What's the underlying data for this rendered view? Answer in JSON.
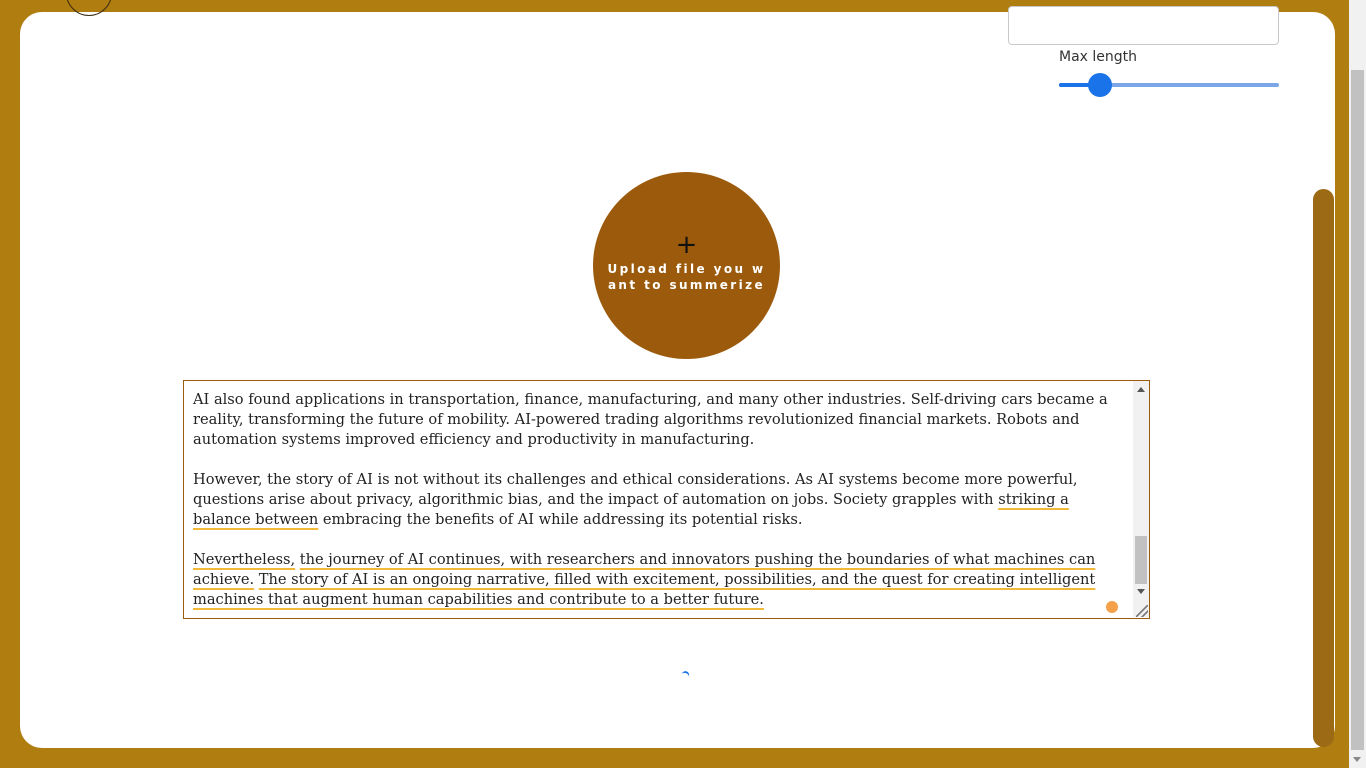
{
  "settings": {
    "max_length_label": "Max length",
    "max_length_value_fraction": 0.12
  },
  "upload": {
    "plus_symbol": "+",
    "label": "Upload file you want to summerize"
  },
  "text_area": {
    "paragraphs": [
      {
        "segments": [
          "AI also found applications in transportation, finance, manufacturing, and many other industries. Self-driving cars became a reality, transforming the future of mobility. AI-powered trading algorithms revolutionized financial markets. Robots and automation systems improved efficiency and productivity in manufacturing."
        ]
      },
      {
        "segments": [
          "However, the story of AI is not without its challenges and ethical considerations. As AI systems become more powerful, questions arise about privacy, algorithmic bias, and the impact of automation on jobs. Society grapples with ",
          "striking a balance between",
          " embracing the benefits of AI while addressing its potential risks."
        ]
      },
      {
        "segments": [
          "Nevertheless,",
          " ",
          "the journey of AI continues, with researchers and innovators pushing the boundaries of what machines can achieve.",
          " ",
          "The story of AI is an ongoing narrative, filled with excitement, possibilities, and the quest for creating intelligent machines that augment human capabilities and contribute to a better future."
        ]
      }
    ]
  },
  "colors": {
    "page_background": "#b07d10",
    "upload_button": "#9c5b0c",
    "slider_accent": "#1a73e8",
    "grammar_underline": "#f2b838"
  }
}
